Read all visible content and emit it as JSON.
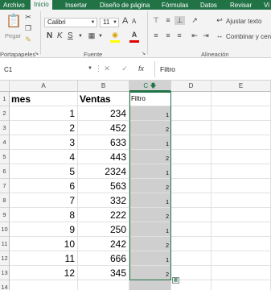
{
  "ribbon_tabs": [
    "Archivo",
    "Inicio",
    "Insertar",
    "Diseño de página",
    "Fórmulas",
    "Datos",
    "Revisar",
    "Vi"
  ],
  "ribbon": {
    "paste_label": "Pegar",
    "font_name": "Calibri",
    "font_size": "11",
    "bold": "N",
    "italic": "K",
    "underline": "S",
    "grow_font": "A",
    "shrink_font": "A",
    "wrap_text": "Ajustar texto",
    "merge_center": "Combinar y cent",
    "groups": {
      "clipboard": "Portapapeles",
      "font": "Fuente",
      "alignment": "Alineación"
    }
  },
  "formula_bar": {
    "name_box": "C1",
    "fx": "fx",
    "value": "Filtro"
  },
  "columns": [
    "A",
    "B",
    "C",
    "D",
    "E"
  ],
  "rows": [
    {
      "num": "1",
      "a": "mes",
      "b": "Ventas",
      "c": "Filtro"
    },
    {
      "num": "2",
      "a": "1",
      "b": "234",
      "c": "1"
    },
    {
      "num": "3",
      "a": "2",
      "b": "452",
      "c": "2"
    },
    {
      "num": "4",
      "a": "3",
      "b": "633",
      "c": "1"
    },
    {
      "num": "5",
      "a": "4",
      "b": "443",
      "c": "2"
    },
    {
      "num": "6",
      "a": "5",
      "b": "2324",
      "c": "1"
    },
    {
      "num": "7",
      "a": "6",
      "b": "563",
      "c": "2"
    },
    {
      "num": "8",
      "a": "7",
      "b": "332",
      "c": "1"
    },
    {
      "num": "9",
      "a": "8",
      "b": "222",
      "c": "2"
    },
    {
      "num": "10",
      "a": "9",
      "b": "250",
      "c": "1"
    },
    {
      "num": "11",
      "a": "10",
      "b": "242",
      "c": "2"
    },
    {
      "num": "12",
      "a": "11",
      "b": "666",
      "c": "1"
    },
    {
      "num": "13",
      "a": "12",
      "b": "345",
      "c": "2"
    },
    {
      "num": "14",
      "a": "",
      "b": "",
      "c": ""
    }
  ]
}
